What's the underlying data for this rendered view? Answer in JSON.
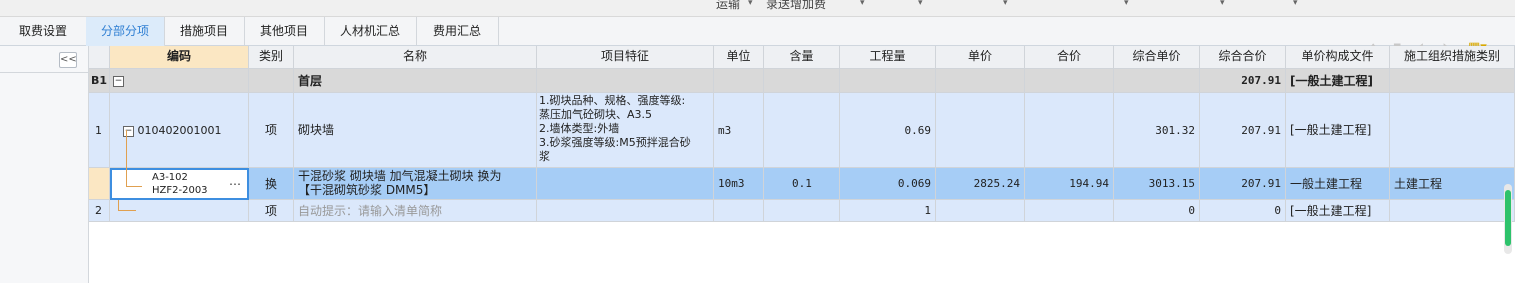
{
  "top": {
    "menu_a": "运输",
    "menu_b": "录送增加费"
  },
  "tabs": [
    {
      "label": "取费设置"
    },
    {
      "label": "分部分项"
    },
    {
      "label": "措施项目"
    },
    {
      "label": "其他项目"
    },
    {
      "label": "人材机汇总"
    },
    {
      "label": "费用汇总"
    }
  ],
  "toolbar": {
    "up_icon": "arrow-up",
    "down_icon": "arrow-down",
    "left_icon": "arrow-left",
    "right_icon": "arrow-right",
    "settings_icon": "grid-settings"
  },
  "left_panel": {
    "collapse_label": "<<"
  },
  "columns": {
    "code": "编码",
    "type": "类别",
    "name": "名称",
    "features": "项目特征",
    "unit": "单位",
    "content": "含量",
    "qty": "工程量",
    "price": "单价",
    "total": "合价",
    "comp_price": "综合单价",
    "comp_total": "综合合价",
    "price_file": "单价构成文件",
    "measure_type": "施工组织措施类别"
  },
  "rows": {
    "b1": {
      "index": "B1",
      "toggle": "−",
      "name": "首层",
      "comp_total": "207.91",
      "price_file": "[一般土建工程]"
    },
    "r1": {
      "index": "1",
      "toggle": "−",
      "code": "010402001001",
      "type": "项",
      "name": "砌块墙",
      "features": [
        "1.砌块品种、规格、强度等级:",
        "蒸压加气砼砌块、A3.5",
        "2.墙体类型:外墙",
        "3.砂浆强度等级:M5预拌混合砂",
        "浆"
      ],
      "unit": "m3",
      "qty": "0.69",
      "comp_price": "301.32",
      "comp_total": "207.91",
      "price_file": "[一般土建工程]"
    },
    "r_sub": {
      "code_line1": "A3-102",
      "code_line2": "HZF2-2003",
      "more": "⋯",
      "type": "换",
      "name_line1": "干混砂浆 砌块墙 加气混凝土砌块  换为",
      "name_line2": "【干混砌筑砂浆 DMM5】",
      "unit": "10m3",
      "content": "0.1",
      "qty": "0.069",
      "price": "2825.24",
      "total": "194.94",
      "comp_price": "3013.15",
      "comp_total": "207.91",
      "price_file": "一般土建工程",
      "measure_type": "土建工程"
    },
    "r2": {
      "index": "2",
      "type": "项",
      "name_hint": "自动提示：请输入清单简称",
      "qty": "1",
      "comp_price": "0",
      "comp_total": "0",
      "price_file": "[一般土建工程]"
    }
  }
}
